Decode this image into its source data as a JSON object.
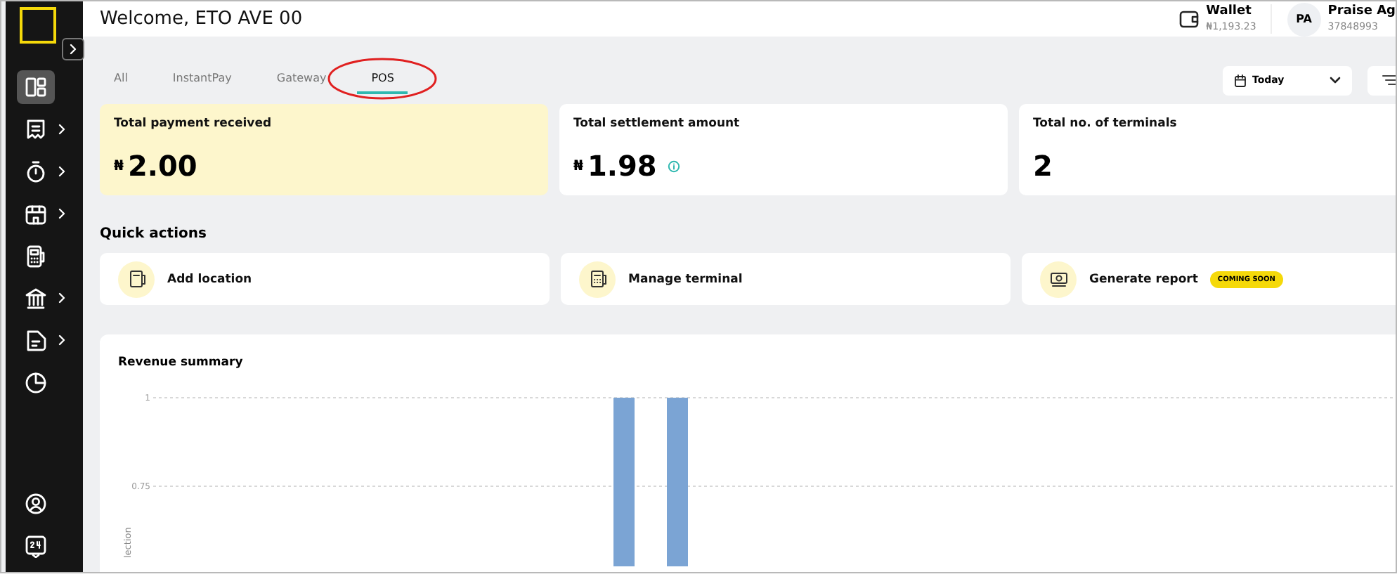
{
  "sidebar": {
    "items": [
      {
        "kind": "dashboard",
        "selected": true,
        "expandable": false
      },
      {
        "kind": "receipt",
        "selected": false,
        "expandable": true
      },
      {
        "kind": "timer",
        "selected": false,
        "expandable": true
      },
      {
        "kind": "store",
        "selected": false,
        "expandable": true
      },
      {
        "kind": "pos",
        "selected": false,
        "expandable": false
      },
      {
        "kind": "bank",
        "selected": false,
        "expandable": true
      },
      {
        "kind": "document",
        "selected": false,
        "expandable": true
      },
      {
        "kind": "chart",
        "selected": false,
        "expandable": false
      }
    ],
    "bottom_items": [
      {
        "kind": "profile"
      },
      {
        "kind": "support"
      }
    ]
  },
  "header": {
    "title": "Welcome, ETO AVE 00",
    "wallet": {
      "label": "Wallet",
      "balance": "₦1,193.23"
    },
    "user": {
      "initials": "PA",
      "name": "Praise Ag",
      "id": "37848993"
    }
  },
  "tabs": [
    {
      "label": "All",
      "selected": false,
      "circled": false
    },
    {
      "label": "InstantPay",
      "selected": false,
      "circled": false
    },
    {
      "label": "Gateway",
      "selected": false,
      "circled": false
    },
    {
      "label": "POS",
      "selected": true,
      "circled": true
    }
  ],
  "date_filter": {
    "value": "Today"
  },
  "stats": [
    {
      "title": "Total payment received",
      "currency": "₦",
      "amount": "2.00",
      "highlighted": true,
      "info": false
    },
    {
      "title": "Total settlement amount",
      "currency": "₦",
      "amount": "1.98",
      "highlighted": false,
      "info": true
    },
    {
      "title": "Total no. of terminals",
      "amount": "2",
      "highlighted": false,
      "info": false
    }
  ],
  "quick_actions": {
    "title": "Quick actions",
    "items": [
      {
        "label": "Add location",
        "kind": "location"
      },
      {
        "label": "Manage terminal",
        "kind": "terminal"
      },
      {
        "label": "Generate report",
        "kind": "report",
        "badge": "COMING SOON"
      }
    ]
  },
  "revenue": {
    "title": "Revenue summary",
    "chart_data": {
      "type": "bar",
      "ylabel": "lection",
      "ylim": [
        0,
        1
      ],
      "yticks": [
        1,
        0.75
      ],
      "values": [
        null,
        null,
        null,
        null,
        null,
        null,
        null,
        null,
        1,
        1,
        null,
        null,
        null,
        null,
        null,
        null,
        null,
        null,
        null,
        null,
        null,
        null,
        null
      ]
    }
  }
}
